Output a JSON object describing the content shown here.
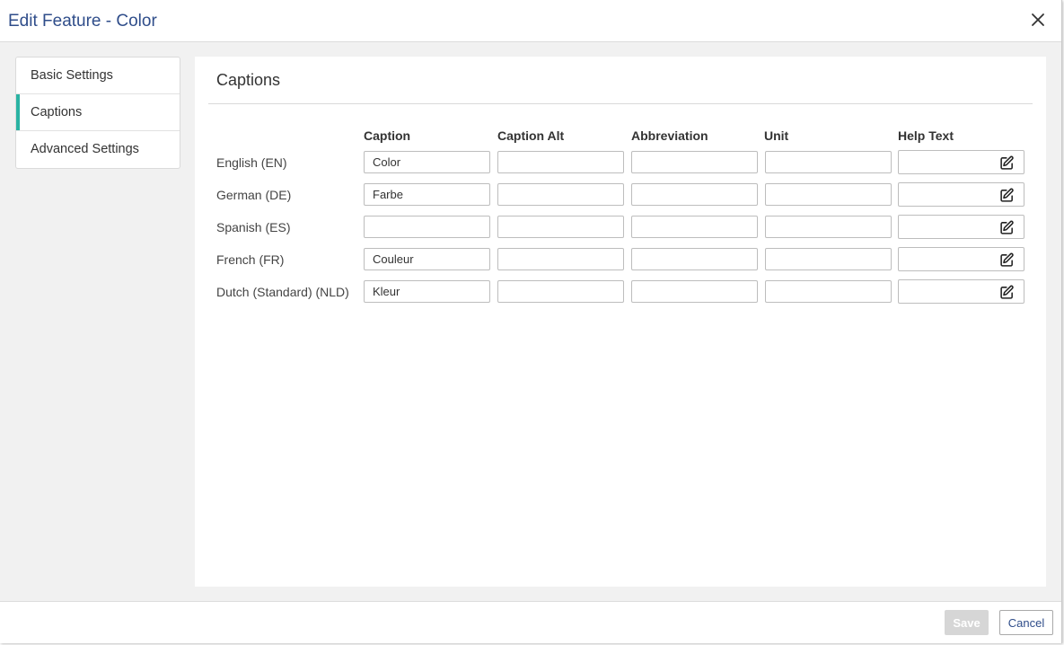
{
  "dialog": {
    "title": "Edit Feature - Color"
  },
  "sidebar": {
    "items": [
      {
        "label": "Basic Settings",
        "active": false
      },
      {
        "label": "Captions",
        "active": true
      },
      {
        "label": "Advanced Settings",
        "active": false
      }
    ]
  },
  "main": {
    "title": "Captions",
    "columns": [
      "Caption",
      "Caption Alt",
      "Abbreviation",
      "Unit",
      "Help Text"
    ],
    "rows": [
      {
        "language": "English (EN)",
        "caption": "Color",
        "caption_alt": "",
        "abbreviation": "",
        "unit": ""
      },
      {
        "language": "German (DE)",
        "caption": "Farbe",
        "caption_alt": "",
        "abbreviation": "",
        "unit": ""
      },
      {
        "language": "Spanish (ES)",
        "caption": "",
        "caption_alt": "",
        "abbreviation": "",
        "unit": ""
      },
      {
        "language": "French (FR)",
        "caption": "Couleur",
        "caption_alt": "",
        "abbreviation": "",
        "unit": ""
      },
      {
        "language": "Dutch (Standard) (NLD)",
        "caption": "Kleur",
        "caption_alt": "",
        "abbreviation": "",
        "unit": ""
      }
    ],
    "help_icon": "edit-icon"
  },
  "footer": {
    "save_label": "Save",
    "cancel_label": "Cancel"
  },
  "colors": {
    "accent": "#2ab3a3",
    "title": "#2f4d8a",
    "save_disabled": "#d6d6d6"
  }
}
